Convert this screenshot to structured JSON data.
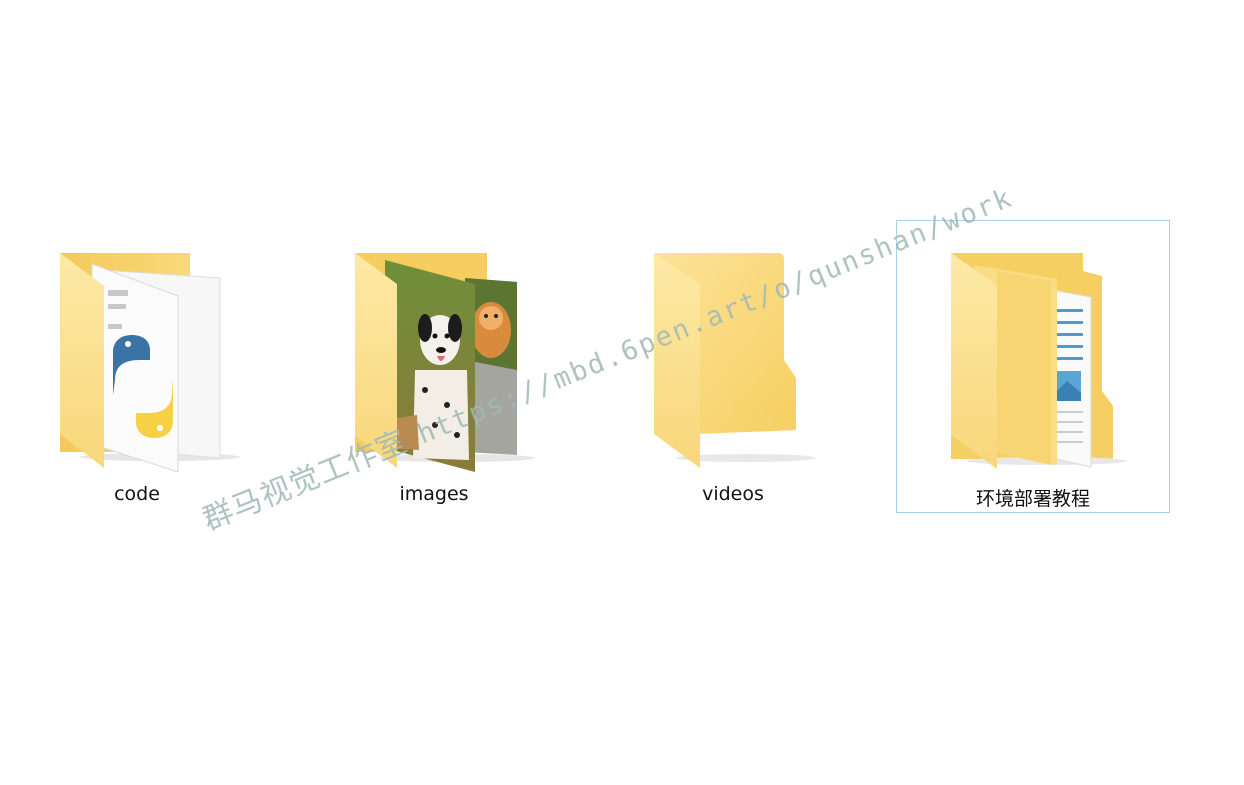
{
  "folders": [
    {
      "label": "code",
      "selected": false
    },
    {
      "label": "images",
      "selected": false
    },
    {
      "label": "videos",
      "selected": false
    },
    {
      "label": "环境部署教程",
      "selected": true
    }
  ],
  "watermark": {
    "text_cn": "群马视觉工作室",
    "text_url": "https://mbd.6pen.art/o/qunshan/work"
  },
  "colors": {
    "folder_back": "#f5cf62",
    "folder_front": "#fde7a2",
    "selection_border": "#a8d2ee",
    "watermark": "#9fb9b7"
  }
}
